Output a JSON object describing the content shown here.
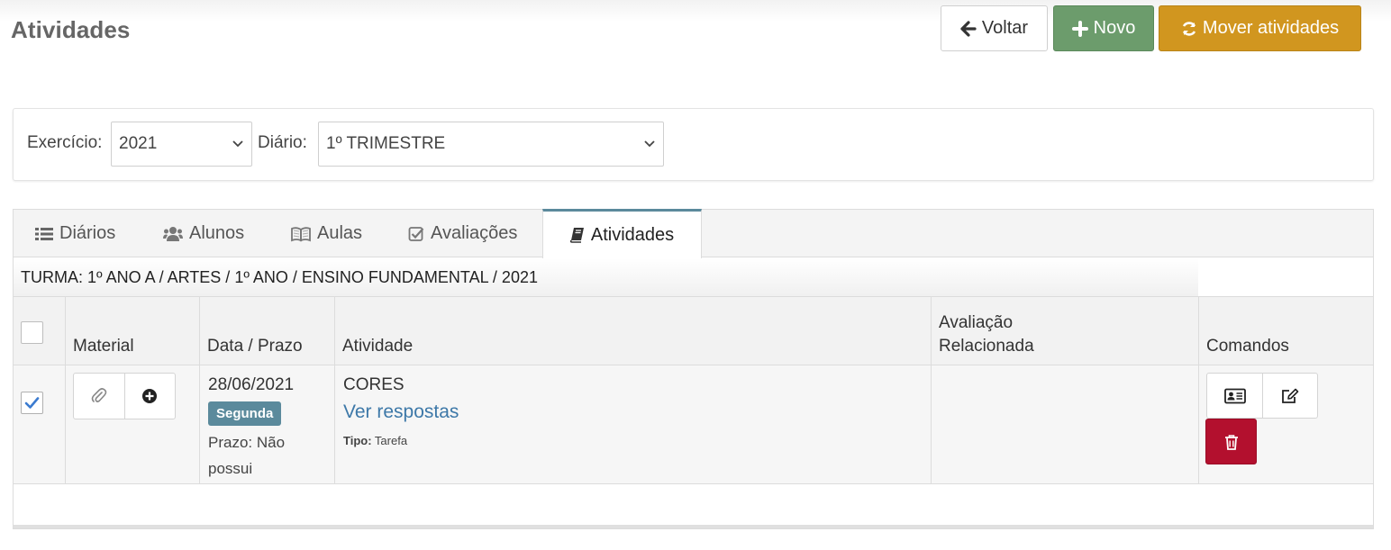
{
  "page": {
    "title": "Atividades"
  },
  "toolbar": {
    "voltar_label": "Voltar",
    "novo_label": "Novo",
    "mover_label": "Mover atividades",
    "colors": {
      "novo": "#6c9c6c",
      "mover": "#d1961f"
    }
  },
  "filters": {
    "exercicio_label": "Exercício:",
    "exercicio_value": "2021",
    "diario_label": "Diário:",
    "diario_value": "1º TRIMESTRE"
  },
  "tabs": [
    {
      "label": "Diários",
      "icon": "list-icon",
      "active": false
    },
    {
      "label": "Alunos",
      "icon": "users-icon",
      "active": false
    },
    {
      "label": "Aulas",
      "icon": "book-open-icon",
      "active": false
    },
    {
      "label": "Avaliações",
      "icon": "check-square-icon",
      "active": false
    },
    {
      "label": "Atividades",
      "icon": "book-icon",
      "active": true
    }
  ],
  "turma": "TURMA: 1º ANO A / ARTES / 1º ANO / ENSINO FUNDAMENTAL / 2021",
  "table": {
    "headers": {
      "material": "Material",
      "data_prazo": "Data / Prazo",
      "atividade": "Atividade",
      "avaliacao_1": "Avaliação",
      "avaliacao_2": "Relacionada",
      "comandos": "Comandos"
    },
    "rows": [
      {
        "checked": true,
        "date": "28/06/2021",
        "weekday": "Segunda",
        "prazo": "Prazo: Não possui",
        "activity": "CORES",
        "link": "Ver respostas",
        "tipo_label": "Tipo:",
        "tipo_value": "Tarefa",
        "avaliacao": ""
      }
    ]
  },
  "colors": {
    "delete": "#b3102e",
    "accent": "#5b8a9c",
    "link": "#3d78a8"
  }
}
